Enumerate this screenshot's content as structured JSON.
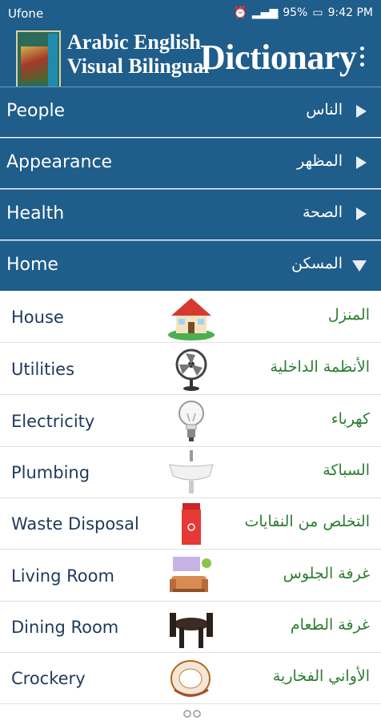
{
  "status": {
    "carrier": "Ufone",
    "battery": "95%",
    "time": "9:42 PM"
  },
  "app": {
    "title_line1": "Arabic English",
    "title_line2": "Visual Bilingual",
    "title_big": "Dictionary",
    "cover_text": "arabic english VISUAL"
  },
  "categories": [
    {
      "en": "People",
      "ar": "الناس",
      "expanded": false
    },
    {
      "en": "Appearance",
      "ar": "المظهر",
      "expanded": false
    },
    {
      "en": "Health",
      "ar": "الصحة",
      "expanded": false
    },
    {
      "en": "Home",
      "ar": "المسكن",
      "expanded": true
    }
  ],
  "items": [
    {
      "en": "House",
      "ar": "المنزل",
      "icon": "house-icon"
    },
    {
      "en": "Utilities",
      "ar": "الأنظمة الداخلية",
      "icon": "fan-icon"
    },
    {
      "en": "Electricity",
      "ar": "كهرباء",
      "icon": "lightbulb-icon"
    },
    {
      "en": "Plumbing",
      "ar": "السباكة",
      "icon": "sink-icon"
    },
    {
      "en": "Waste Disposal",
      "ar": "التخلص من النفايات",
      "icon": "trash-bin-icon"
    },
    {
      "en": "Living Room",
      "ar": "غرفة الجلوس",
      "icon": "sofa-icon"
    },
    {
      "en": "Dining Room",
      "ar": "غرفة الطعام",
      "icon": "dining-table-icon"
    },
    {
      "en": "Crockery",
      "ar": "الأواني الفخارية",
      "icon": "plates-icon"
    }
  ]
}
